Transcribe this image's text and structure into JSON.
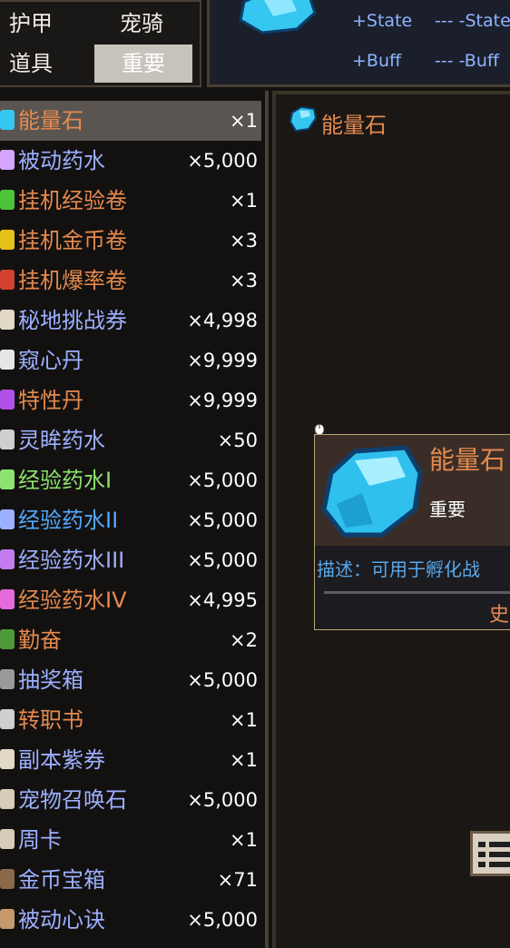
{
  "tabs": [
    {
      "label": "护甲",
      "active": false
    },
    {
      "label": "宠骑",
      "active": false
    },
    {
      "label": "道具",
      "active": false
    },
    {
      "label": "重要",
      "active": true
    }
  ],
  "state_panel": {
    "plus_state": "+State",
    "minus_state": "--- -State",
    "plus_buff": "+Buff",
    "minus_buff": "--- -Buff"
  },
  "items": [
    {
      "name": "能量石",
      "qty": "×1",
      "color": "#e58a4f",
      "icon": "crystal-icon",
      "icon_color": "#35c7ef",
      "selected": true
    },
    {
      "name": "被动药水",
      "qty": "×5,000",
      "color": "#9db0ff",
      "icon": "potion-icon",
      "icon_color": "#d3a5ff"
    },
    {
      "name": "挂机经验卷",
      "qty": "×1",
      "color": "#e58a4f",
      "icon": "scroll-green-icon",
      "icon_color": "#4cc43a"
    },
    {
      "name": "挂机金币卷",
      "qty": "×3",
      "color": "#e58a4f",
      "icon": "scroll-gold-icon",
      "icon_color": "#e5c21a"
    },
    {
      "name": "挂机爆率卷",
      "qty": "×3",
      "color": "#e58a4f",
      "icon": "scroll-red-icon",
      "icon_color": "#d2422e"
    },
    {
      "name": "秘地挑战券",
      "qty": "×4,998",
      "color": "#9db0ff",
      "icon": "ticket-icon",
      "icon_color": "#e2d9c6"
    },
    {
      "name": "窥心丹",
      "qty": "×9,999",
      "color": "#9db0ff",
      "icon": "pill-white-icon",
      "icon_color": "#e6e6e6"
    },
    {
      "name": "特性丹",
      "qty": "×9,999",
      "color": "#e58a4f",
      "icon": "pill-purple-icon",
      "icon_color": "#b050e8"
    },
    {
      "name": "灵眸药水",
      "qty": "×50",
      "color": "#9db0ff",
      "icon": "vial-icon",
      "icon_color": "#cfcfcf"
    },
    {
      "name": "经验药水I",
      "qty": "×5,000",
      "color": "#8ee36e",
      "icon": "flask-green-icon",
      "icon_color": "#8ee36e"
    },
    {
      "name": "经验药水II",
      "qty": "×5,000",
      "color": "#53a8ff",
      "icon": "flask-blue-icon",
      "icon_color": "#9db0ff"
    },
    {
      "name": "经验药水III",
      "qty": "×5,000",
      "color": "#9db0ff",
      "icon": "flask-purple-icon",
      "icon_color": "#c27cf0"
    },
    {
      "name": "经验药水IV",
      "qty": "×4,995",
      "color": "#e58a4f",
      "icon": "flask-pink-icon",
      "icon_color": "#e66ad9"
    },
    {
      "name": "勤奋",
      "qty": "×2",
      "color": "#e58a4f",
      "icon": "book-green-icon",
      "icon_color": "#4e9a3a"
    },
    {
      "name": "抽奖箱",
      "qty": "×5,000",
      "color": "#9db0ff",
      "icon": "lottery-box-icon",
      "icon_color": "#9a9a9a"
    },
    {
      "name": "转职书",
      "qty": "×1",
      "color": "#e58a4f",
      "icon": "book-dark-icon",
      "icon_color": "#cfcfcf"
    },
    {
      "name": "副本紫券",
      "qty": "×1",
      "color": "#9db0ff",
      "icon": "ticket-purple-icon",
      "icon_color": "#e2d9c6"
    },
    {
      "name": "宠物召唤石",
      "qty": "×5,000",
      "color": "#9db0ff",
      "icon": "summon-stone-icon",
      "icon_color": "#d6cdb8"
    },
    {
      "name": "周卡",
      "qty": "×1",
      "color": "#9db0ff",
      "icon": "card-icon",
      "icon_color": "#d6cdb8"
    },
    {
      "name": "金币宝箱",
      "qty": "×71",
      "color": "#9db0ff",
      "icon": "chest-icon",
      "icon_color": "#8a6a4a"
    },
    {
      "name": "被动心诀",
      "qty": "×5,000",
      "color": "#9db0ff",
      "icon": "scroll-icon",
      "icon_color": "#c49a6c"
    }
  ],
  "detail": {
    "title": "能量石",
    "card_name": "能量石",
    "card_category": "重要",
    "description": "描述：可用于孵化战",
    "footer_text": "史"
  }
}
